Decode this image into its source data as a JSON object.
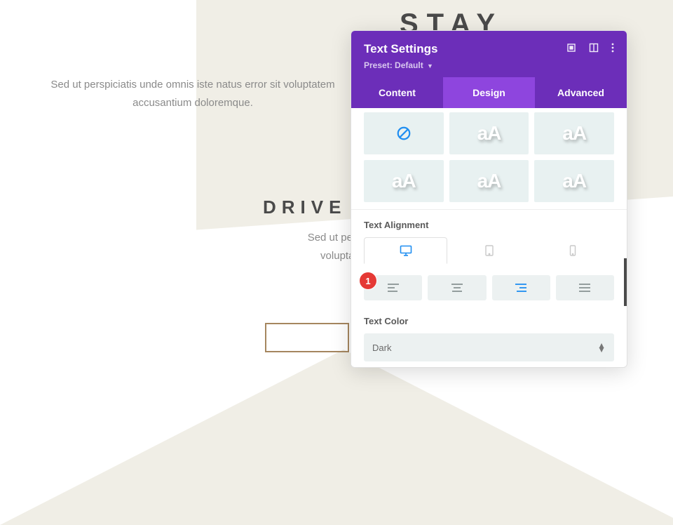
{
  "background": {
    "headline1": "STAY ORGANI",
    "para1": "Sed ut perspiciatis unde omnis iste natus error sit voluptatem accusantium doloremque.",
    "headline2": "DRIVE",
    "para2_line1": "Sed ut perspiciatis",
    "para2_line2": "voluptatem a"
  },
  "panel": {
    "title": "Text Settings",
    "preset_label": "Preset:",
    "preset_value": "Default",
    "tabs": {
      "content": "Content",
      "design": "Design",
      "advanced": "Advanced"
    },
    "text_styles": {
      "options": [
        "none",
        "aA",
        "aA",
        "aA",
        "aA",
        "aA"
      ]
    },
    "sections": {
      "text_alignment_label": "Text Alignment",
      "text_color_label": "Text Color"
    },
    "devices": [
      "desktop",
      "tablet",
      "phone"
    ],
    "active_device": "desktop",
    "alignment_options": [
      "left",
      "center",
      "right",
      "justify"
    ],
    "active_alignment": "right",
    "text_color_value": "Dark"
  },
  "annotation": {
    "num": "1"
  }
}
